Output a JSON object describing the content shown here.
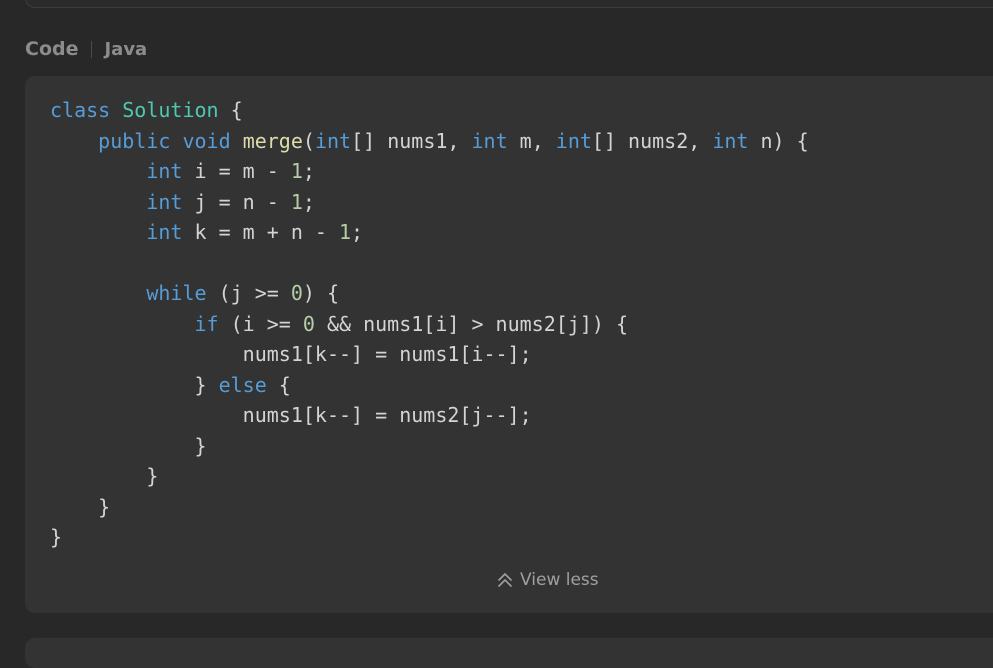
{
  "section": {
    "title": "Code",
    "language": "Java"
  },
  "code": {
    "lines": [
      [
        {
          "t": "class",
          "c": "kw"
        },
        {
          "t": " "
        },
        {
          "t": "Solution",
          "c": "cls"
        },
        {
          "t": " {"
        }
      ],
      [
        {
          "t": "    "
        },
        {
          "t": "public",
          "c": "kw"
        },
        {
          "t": " "
        },
        {
          "t": "void",
          "c": "kw"
        },
        {
          "t": " "
        },
        {
          "t": "merge",
          "c": "fn"
        },
        {
          "t": "("
        },
        {
          "t": "int",
          "c": "kw"
        },
        {
          "t": "[] nums1, "
        },
        {
          "t": "int",
          "c": "kw"
        },
        {
          "t": " m, "
        },
        {
          "t": "int",
          "c": "kw"
        },
        {
          "t": "[] nums2, "
        },
        {
          "t": "int",
          "c": "kw"
        },
        {
          "t": " n) {"
        }
      ],
      [
        {
          "t": "        "
        },
        {
          "t": "int",
          "c": "kw"
        },
        {
          "t": " i = m - "
        },
        {
          "t": "1",
          "c": "num"
        },
        {
          "t": ";"
        }
      ],
      [
        {
          "t": "        "
        },
        {
          "t": "int",
          "c": "kw"
        },
        {
          "t": " j = n - "
        },
        {
          "t": "1",
          "c": "num"
        },
        {
          "t": ";"
        }
      ],
      [
        {
          "t": "        "
        },
        {
          "t": "int",
          "c": "kw"
        },
        {
          "t": " k = m + n - "
        },
        {
          "t": "1",
          "c": "num"
        },
        {
          "t": ";"
        }
      ],
      [],
      [
        {
          "t": "        "
        },
        {
          "t": "while",
          "c": "kw"
        },
        {
          "t": " (j >= "
        },
        {
          "t": "0",
          "c": "num"
        },
        {
          "t": ") {"
        }
      ],
      [
        {
          "t": "            "
        },
        {
          "t": "if",
          "c": "kw"
        },
        {
          "t": " (i >= "
        },
        {
          "t": "0",
          "c": "num"
        },
        {
          "t": " && nums1[i] > nums2[j]) {"
        }
      ],
      [
        {
          "t": "                nums1[k--] = nums1[i--];"
        }
      ],
      [
        {
          "t": "            } "
        },
        {
          "t": "else",
          "c": "kw"
        },
        {
          "t": " {"
        }
      ],
      [
        {
          "t": "                nums1[k--] = nums2[j--];"
        }
      ],
      [
        {
          "t": "            }"
        }
      ],
      [
        {
          "t": "        }"
        }
      ],
      [
        {
          "t": "    }"
        }
      ],
      [
        {
          "t": "}"
        }
      ]
    ]
  },
  "toggle": {
    "label": "View less",
    "icon": "chevrons-up-icon"
  },
  "colors": {
    "keyword": "#569cd6",
    "class": "#4ec9b0",
    "function": "#dcdcaa",
    "number": "#b5cea8",
    "text": "#d4d4d4"
  }
}
